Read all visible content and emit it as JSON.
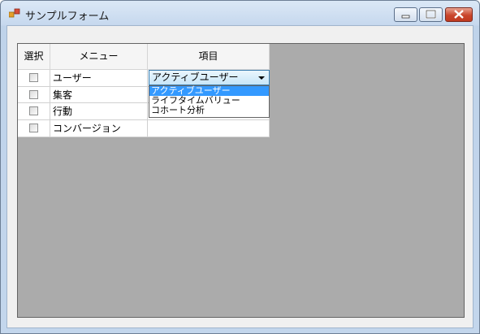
{
  "window": {
    "title": "サンプルフォーム"
  },
  "grid": {
    "headers": [
      "選択",
      "メニュー",
      "項目"
    ],
    "rows": [
      {
        "menu": "ユーザー",
        "checked": false
      },
      {
        "menu": "集客",
        "checked": false
      },
      {
        "menu": "行動",
        "checked": false
      },
      {
        "menu": "コンバージョン",
        "checked": false
      }
    ]
  },
  "combo": {
    "value": "アクティブユーザー",
    "options": [
      "アクティブユーザー",
      "ライフタイムバリュー",
      "コホート分析"
    ]
  }
}
